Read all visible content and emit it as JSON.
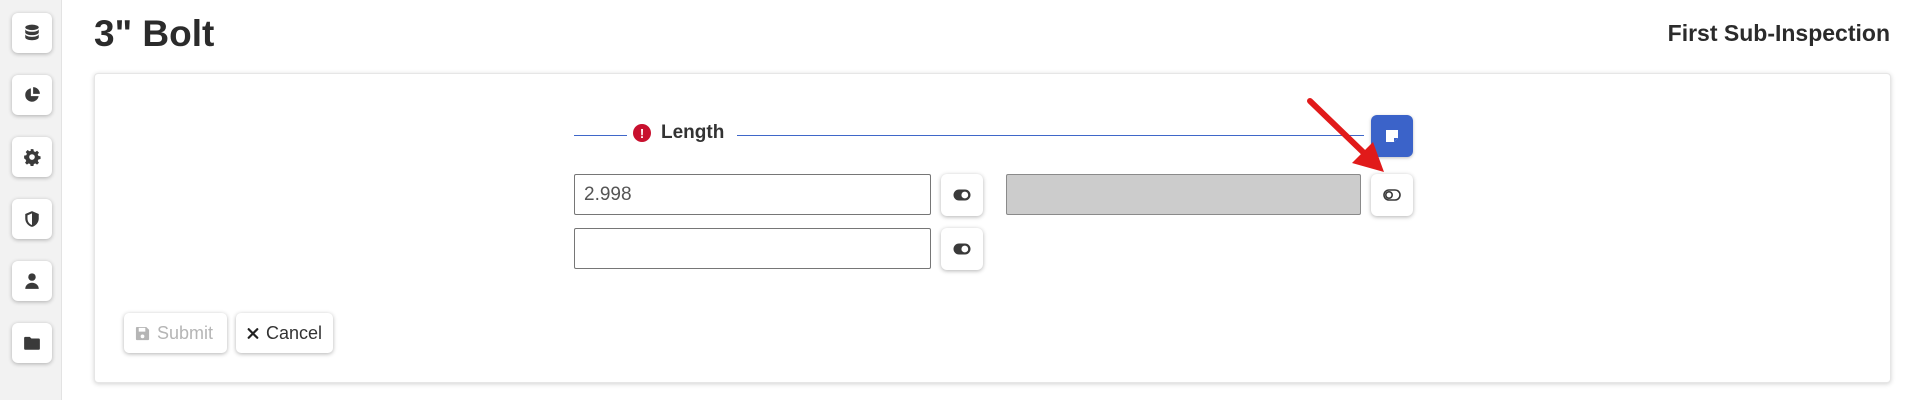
{
  "header": {
    "title": "3\" Bolt",
    "subtitle": "First Sub-Inspection"
  },
  "sidebar": {
    "items": [
      {
        "icon": "database-icon"
      },
      {
        "icon": "pie-chart-icon"
      },
      {
        "icon": "gear-icon"
      },
      {
        "icon": "shield-icon"
      },
      {
        "icon": "user-icon"
      },
      {
        "icon": "folder-icon"
      }
    ]
  },
  "section": {
    "label": "Length",
    "status_icon": "error-icon",
    "status_color": "#c8102e",
    "accent_color": "#3b63c9"
  },
  "fields": {
    "measurement_1": {
      "value": "2.998",
      "placeholder": ""
    },
    "measurement_2": {
      "value": "",
      "placeholder": ""
    },
    "secondary": {
      "value": "",
      "disabled": true
    }
  },
  "actions": {
    "submit_label": "Submit",
    "cancel_label": "Cancel",
    "submit_disabled": true
  },
  "annotation": {
    "arrow_color": "#e11a1a"
  }
}
